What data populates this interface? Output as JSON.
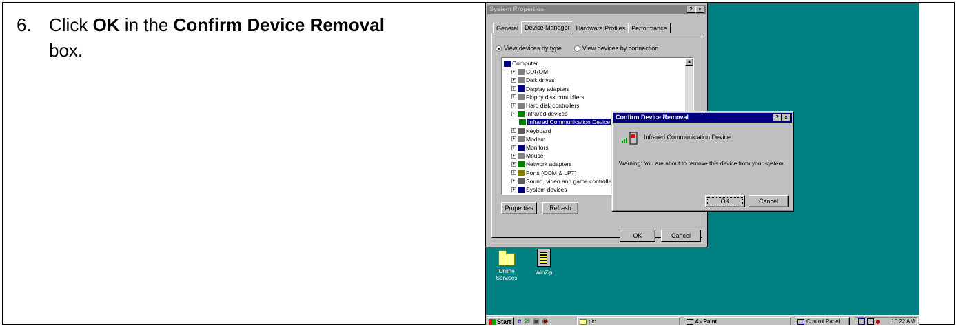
{
  "instruction": {
    "number": "6.",
    "pre": "Click ",
    "ok": "OK",
    "mid": " in the ",
    "dialog_name": "Confirm Device Removal",
    "post": " box."
  },
  "system_properties": {
    "title": "System Properties",
    "title_buttons": [
      "?",
      "×"
    ],
    "tabs": [
      "General",
      "Device Manager",
      "Hardware Profiles",
      "Performance"
    ],
    "active_tab": "Device Manager",
    "radio_by_type": "View devices by type",
    "radio_by_connection": "View devices by connection",
    "tree": [
      {
        "label": "Computer",
        "indent": 0,
        "expander": "",
        "icon": "computer-icon",
        "color": "#000080"
      },
      {
        "label": "CDROM",
        "indent": 1,
        "expander": "+",
        "icon": "cdrom-icon",
        "color": "#808080"
      },
      {
        "label": "Disk drives",
        "indent": 1,
        "expander": "+",
        "icon": "disk-drive-icon",
        "color": "#808080"
      },
      {
        "label": "Display adapters",
        "indent": 1,
        "expander": "+",
        "icon": "display-adapter-icon",
        "color": "#000080"
      },
      {
        "label": "Floppy disk controllers",
        "indent": 1,
        "expander": "+",
        "icon": "floppy-controller-icon",
        "color": "#808080"
      },
      {
        "label": "Hard disk controllers",
        "indent": 1,
        "expander": "+",
        "icon": "hard-disk-controller-icon",
        "color": "#808080"
      },
      {
        "label": "Infrared devices",
        "indent": 1,
        "expander": "-",
        "icon": "infrared-icon",
        "color": "#008000"
      },
      {
        "label": "Infrared Communication Device",
        "indent": 2,
        "expander": "",
        "icon": "infrared-device-icon",
        "color": "#008000",
        "selected": true
      },
      {
        "label": "Keyboard",
        "indent": 1,
        "expander": "+",
        "icon": "keyboard-icon",
        "color": "#606060"
      },
      {
        "label": "Modem",
        "indent": 1,
        "expander": "+",
        "icon": "modem-icon",
        "color": "#808080"
      },
      {
        "label": "Monitors",
        "indent": 1,
        "expander": "+",
        "icon": "monitor-icon",
        "color": "#000080"
      },
      {
        "label": "Mouse",
        "indent": 1,
        "expander": "+",
        "icon": "mouse-icon",
        "color": "#808080"
      },
      {
        "label": "Network adapters",
        "indent": 1,
        "expander": "+",
        "icon": "network-adapter-icon",
        "color": "#008000"
      },
      {
        "label": "Ports (COM & LPT)",
        "indent": 1,
        "expander": "+",
        "icon": "ports-icon",
        "color": "#808000"
      },
      {
        "label": "Sound, video and game controllers",
        "indent": 1,
        "expander": "+",
        "icon": "sound-icon",
        "color": "#606060"
      },
      {
        "label": "System devices",
        "indent": 1,
        "expander": "+",
        "icon": "system-devices-icon",
        "color": "#000080"
      }
    ],
    "buttons": {
      "properties": "Properties",
      "refresh": "Refresh",
      "ok": "OK",
      "cancel": "Cancel"
    }
  },
  "confirm_dialog": {
    "title": "Confirm Device Removal",
    "title_buttons": [
      "?",
      "×"
    ],
    "device_name": "Infrared Communication Device",
    "warning": "Warning: You are about to remove this device from your system.",
    "ok_label": "OK",
    "cancel_label": "Cancel"
  },
  "desktop": {
    "icons": [
      {
        "label_line1": "Online",
        "label_line2": "Services"
      },
      {
        "label_line1": "WinZip",
        "label_line2": ""
      }
    ]
  },
  "taskbar": {
    "start_label": "Start",
    "items": [
      "pic",
      "4 - Paint",
      "Control Panel"
    ],
    "clock": "10:22 AM"
  },
  "colors": {
    "desktop": "#008080",
    "active_title": "#000080",
    "inactive_title": "#808080",
    "face": "#c0c0c0"
  }
}
